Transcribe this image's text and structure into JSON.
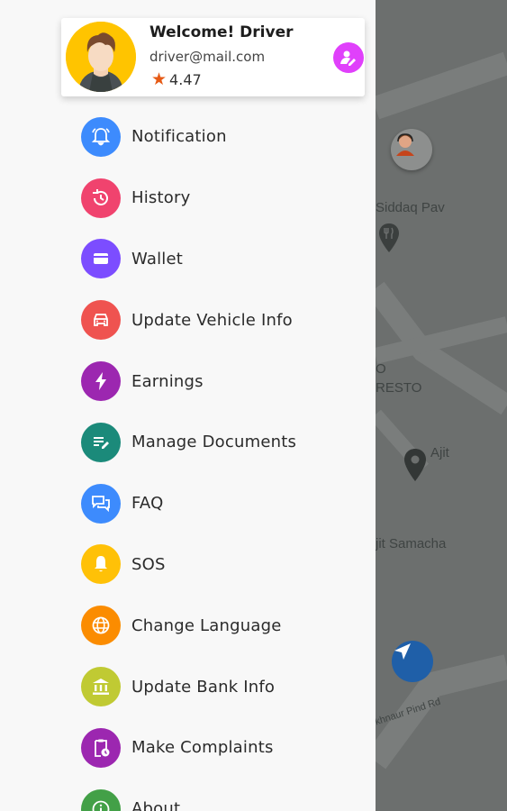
{
  "map": {
    "places": [
      "Siddaq Pav",
      "O",
      "RESTO",
      "Ajit",
      "jit Samacha"
    ],
    "road": "ukhnaur Pind Rd"
  },
  "profile": {
    "greeting": "Welcome! Driver",
    "email": "driver@mail.com",
    "rating": "4.47"
  },
  "menu": [
    {
      "label": "Notification",
      "color": "#3d8bfd",
      "icon": "bell-icon"
    },
    {
      "label": "History",
      "color": "#f0436e",
      "icon": "history-icon"
    },
    {
      "label": "Wallet",
      "color": "#7c4dff",
      "icon": "wallet-icon"
    },
    {
      "label": "Update Vehicle Info",
      "color": "#ef5350",
      "icon": "car-icon"
    },
    {
      "label": "Earnings",
      "color": "#9c27b0",
      "icon": "lightning-icon"
    },
    {
      "label": "Manage Documents",
      "color": "#1b8a7a",
      "icon": "document-edit-icon"
    },
    {
      "label": "FAQ",
      "color": "#3d8bfd",
      "icon": "chat-icon"
    },
    {
      "label": "SOS",
      "color": "#ffc107",
      "icon": "alarm-bell-icon"
    },
    {
      "label": "Change Language",
      "color": "#fb8c00",
      "icon": "globe-icon"
    },
    {
      "label": "Update Bank Info",
      "color": "#c0ca33",
      "icon": "bank-icon"
    },
    {
      "label": "Make Complaints",
      "color": "#9c27b0",
      "icon": "clipboard-clock-icon"
    },
    {
      "label": "About",
      "color": "#43a047",
      "icon": "info-icon"
    }
  ]
}
